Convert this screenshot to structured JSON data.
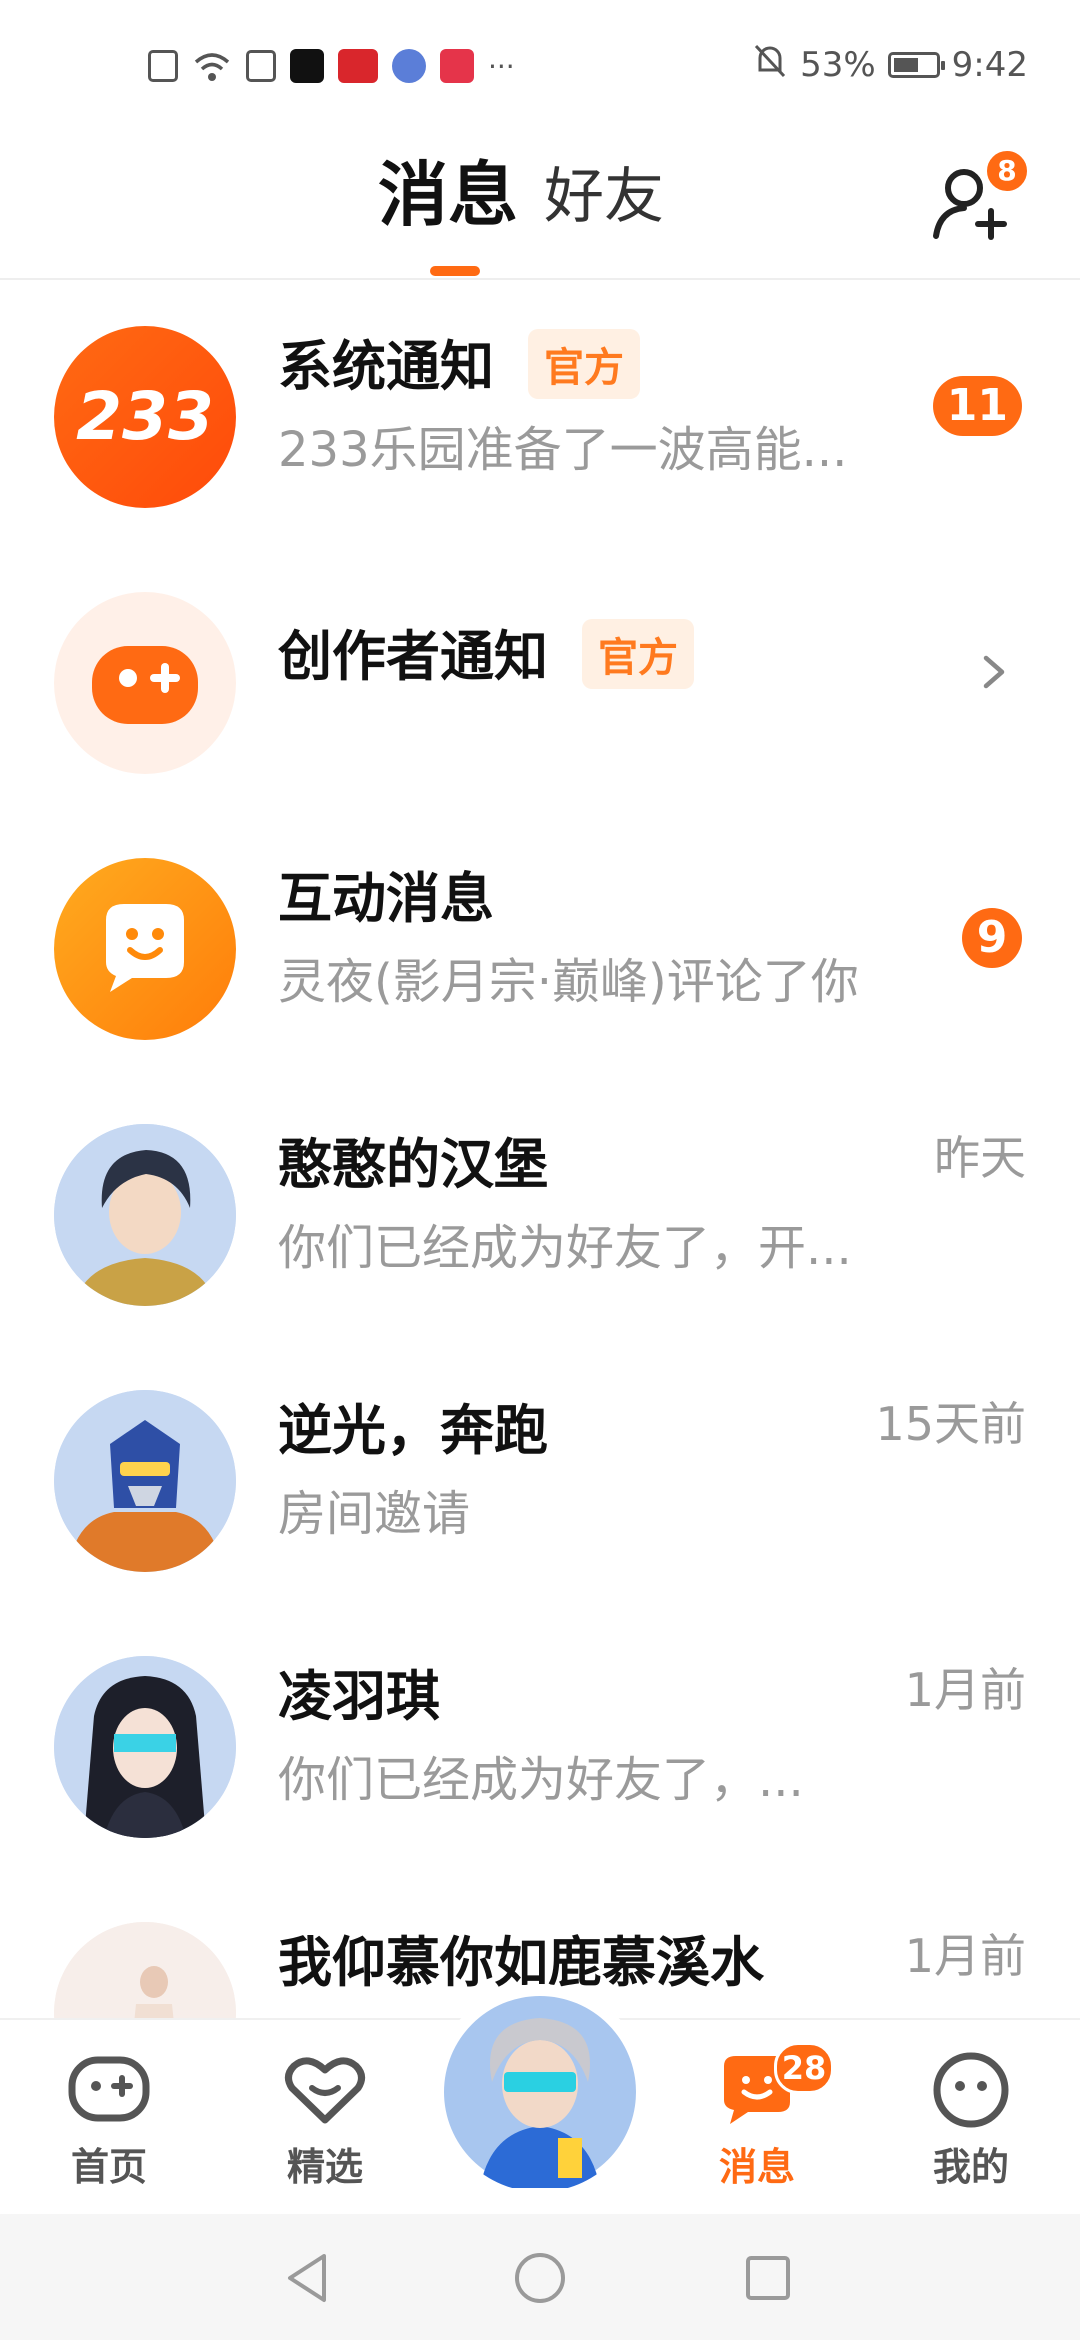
{
  "status_bar": {
    "battery": "53%",
    "time": "9:42",
    "more": "···",
    "icons": [
      "alert-icon",
      "wifi-icon",
      "upload-icon",
      "tiktok-icon",
      "search-app-icon",
      "music-app-icon",
      "book-app-icon",
      "mute-bell-icon",
      "battery-icon"
    ]
  },
  "header": {
    "tabs": [
      {
        "label": "消息",
        "active": true
      },
      {
        "label": "好友",
        "active": false
      }
    ],
    "add_friend_badge": "8"
  },
  "messages": [
    {
      "name": "系统通知",
      "tag": "官方",
      "preview": "233乐园准备了一波高能...",
      "time": "",
      "count": "11",
      "avatar_text": "233",
      "avatar_icon": "brand-233-logo"
    },
    {
      "name": "创作者通知",
      "tag": "官方",
      "preview": "",
      "time": "",
      "count": "",
      "avatar_icon": "gamepad-plus-icon"
    },
    {
      "name": "互动消息",
      "tag": "",
      "preview": "灵夜(影月宗·巅峰)评论了你",
      "time": "",
      "count": "9",
      "avatar_icon": "smiley-chat-icon"
    },
    {
      "name": "憨憨的汉堡",
      "tag": "",
      "preview": "你们已经成为好友了，开...",
      "time": "昨天",
      "count": "",
      "avatar_icon": "user-avatar"
    },
    {
      "name": "逆光，奔跑",
      "tag": "",
      "preview": "房间邀请",
      "time": "15天前",
      "count": "",
      "avatar_icon": "user-avatar"
    },
    {
      "name": "凌羽琪",
      "tag": "",
      "preview": "你们已经成为好友了，...",
      "time": "1月前",
      "count": "",
      "avatar_icon": "user-avatar"
    },
    {
      "name": "我仰慕你如鹿慕溪水",
      "tag": "",
      "preview": "",
      "time": "1月前",
      "count": "",
      "avatar_icon": "user-avatar"
    }
  ],
  "bottom_nav": [
    {
      "label": "首页",
      "icon": "gamepad-icon",
      "active": false
    },
    {
      "label": "精选",
      "icon": "heart-icon",
      "active": false
    },
    {
      "label": "",
      "icon": "center-avatar",
      "active": false
    },
    {
      "label": "消息",
      "icon": "message-icon",
      "active": true,
      "badge": "28"
    },
    {
      "label": "我的",
      "icon": "face-icon",
      "active": false
    }
  ],
  "colors": {
    "accent": "#ff6a13",
    "secondary_text": "#9a9a9a",
    "tag_bg": "#fff0e3"
  }
}
